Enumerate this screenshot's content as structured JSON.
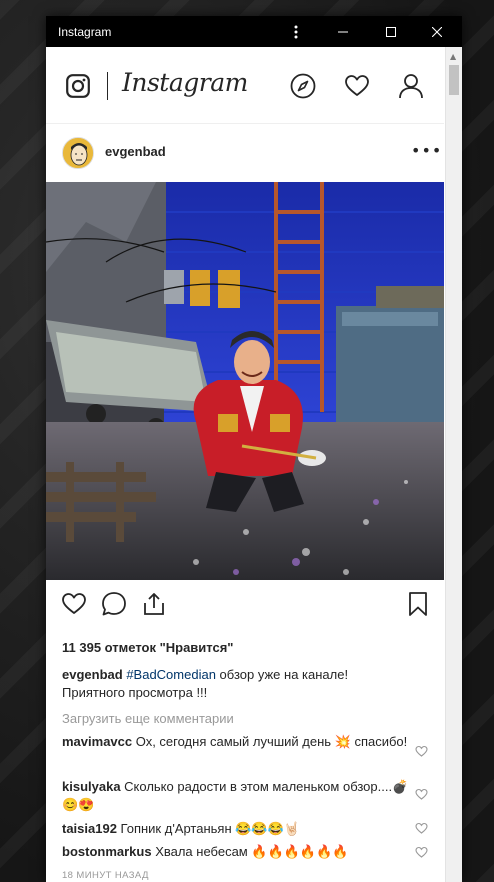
{
  "window": {
    "title": "Instagram"
  },
  "header": {
    "brand": "Instagram"
  },
  "post": {
    "username": "evgenbad",
    "likes": "11 395 отметок \"Нравится\"",
    "caption": {
      "username": "evgenbad",
      "hashtag": "#BadComedian",
      "text": " обзор уже на канале! Приятного просмотра !!!"
    },
    "load_more": "Загрузить еще комментарии",
    "comments": [
      {
        "username": "mavimavcc",
        "text": " Ох, сегодня самый лучший день 💥 спасибо!"
      },
      {
        "username": "kisulyaka",
        "text": " Сколько радости в этом маленьком обзор....💣😊😍"
      },
      {
        "username": "taisia192",
        "text": " Гопник д'Артаньян 😂😂😂🤘🏻"
      },
      {
        "username": "bostonmarkus",
        "text": " Хвала небесам 🔥🔥🔥🔥🔥🔥"
      }
    ],
    "timestamp": "18 МИНУТ НАЗАД"
  },
  "icons": {
    "more_menu": "more-vertical-icon",
    "minimize": "minimize-icon",
    "maximize": "maximize-icon",
    "close": "close-icon",
    "explore": "compass-icon",
    "activity": "heart-icon",
    "profile": "person-icon",
    "like": "heart-icon",
    "comment": "comment-icon",
    "share": "share-icon",
    "save": "bookmark-icon"
  },
  "colors": {
    "titlebar": "#000000",
    "hashtag": "#003569",
    "muted": "#999999",
    "text": "#262626",
    "wall": "#2432b4",
    "jacket": "#c81e28"
  }
}
